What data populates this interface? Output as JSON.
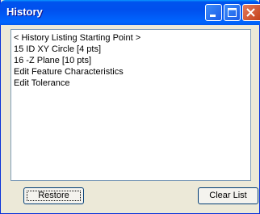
{
  "window": {
    "title": "History"
  },
  "titlebar_buttons": [
    "minimize-icon",
    "maximize-icon",
    "close-icon"
  ],
  "history_list": {
    "items": [
      "< History Listing Starting Point >",
      "15 ID XY Circle [4 pts]",
      "16 -Z Plane [10 pts]",
      "Edit Feature Characteristics",
      "Edit Tolerance"
    ]
  },
  "buttons": {
    "restore": "Restore",
    "clear_list": "Clear List"
  },
  "colors": {
    "titlebar": "#0054e3",
    "close_button": "#d7542b",
    "window_bg": "#ece9d8"
  }
}
